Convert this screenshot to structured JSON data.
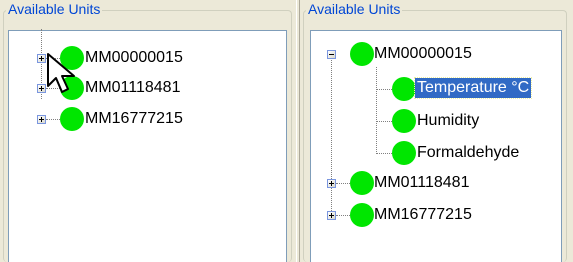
{
  "left_panel": {
    "title": "Available Units",
    "nodes": [
      {
        "label": "MM00000015",
        "expander": "+"
      },
      {
        "label": "MM01118481",
        "expander": "+"
      },
      {
        "label": "MM16777215",
        "expander": "+"
      }
    ]
  },
  "right_panel": {
    "title": "Available Units",
    "nodes": [
      {
        "label": "MM00000015",
        "expander": "-",
        "children": [
          {
            "label": "Temperature °C",
            "selected": true
          },
          {
            "label": "Humidity"
          },
          {
            "label": "Formaldehyde"
          }
        ]
      },
      {
        "label": "MM01118481",
        "expander": "+"
      },
      {
        "label": "MM16777215",
        "expander": "+"
      }
    ]
  },
  "colors": {
    "status_dot": "#00e600",
    "title": "#0046d5",
    "selection": "#316ac5"
  },
  "icons": {
    "status": "green-circle",
    "cursor": "arrow-pointer"
  }
}
